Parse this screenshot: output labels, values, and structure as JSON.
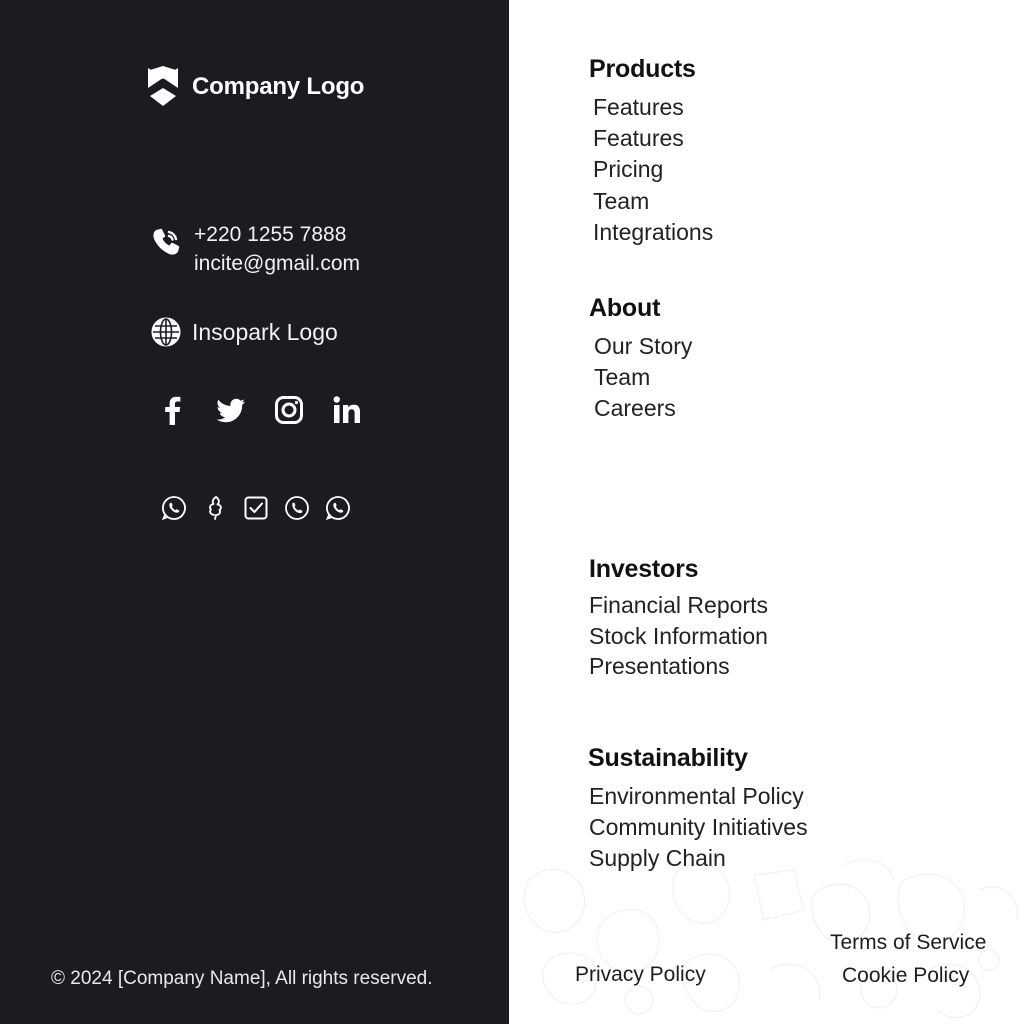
{
  "brand": {
    "name": "Company Logo",
    "icon": "company-logo-icon"
  },
  "contact": {
    "phone": "+220 1255 7888",
    "email": "incite@gmail.com",
    "icon": "phone-icon"
  },
  "website": {
    "label": "Insopark Logo",
    "icon": "globe-icon"
  },
  "social": [
    "facebook-icon",
    "twitter-icon",
    "instagram-icon",
    "linkedin-icon"
  ],
  "mini_icons": [
    "whatsapp-icon",
    "leaf-icon",
    "checkbox-icon",
    "phone-circle-icon",
    "whatsapp-alt-icon"
  ],
  "copyright": "© 2024 [Company Name], All rights reserved.",
  "nav": {
    "products": {
      "title": "Products",
      "items": [
        "Features",
        "Features",
        "Pricing",
        "Team",
        "Integrations"
      ]
    },
    "about": {
      "title": "About",
      "items": [
        "Our Story",
        "Team",
        "Careers"
      ]
    },
    "investors": {
      "title": "Investors",
      "items": [
        "Financial Reports",
        "Stock Information",
        "Presentations"
      ]
    },
    "sustainability": {
      "title": "Sustainability",
      "items": [
        "Environmental Policy",
        "Community Initiatives",
        "Supply Chain"
      ]
    }
  },
  "legal": {
    "privacy": "Privacy Policy",
    "terms": "Terms of Service",
    "cookie": "Cookie Policy"
  },
  "colors": {
    "dark_panel": "#1a1c22",
    "light_panel": "#ffffff",
    "text_light": "#ffffff",
    "text_dark": "#1a1a1a"
  }
}
